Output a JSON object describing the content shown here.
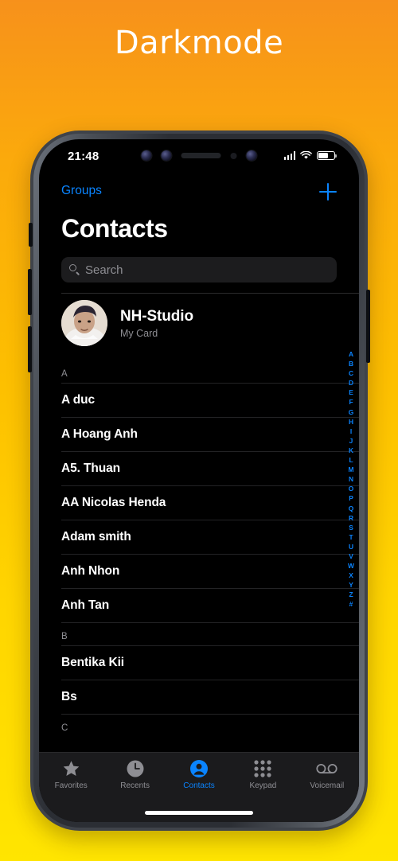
{
  "page": {
    "heading": "Darkmode"
  },
  "colors": {
    "accent": "#0a84ff",
    "screen_bg": "#000000",
    "secondary_text": "#8e8e93",
    "bg_gradient_top": "#f7911b",
    "bg_gradient_bottom": "#ffe500"
  },
  "status_bar": {
    "time": "21:48",
    "signal_icon": "cellular-signal-icon",
    "wifi_icon": "wifi-icon",
    "battery_icon": "battery-icon",
    "battery_level_percent": 62
  },
  "nav_bar": {
    "groups_label": "Groups",
    "add_icon": "plus-icon"
  },
  "header": {
    "title": "Contacts"
  },
  "search": {
    "placeholder": "Search",
    "value": "",
    "icon": "search-icon"
  },
  "my_card": {
    "name": "NH-Studio",
    "subtitle": "My Card",
    "avatar": "user-photo-avatar"
  },
  "contacts": {
    "sections": [
      {
        "letter": "A",
        "rows": [
          "A duc",
          "A Hoang Anh",
          "A5. Thuan",
          "AA Nicolas Henda",
          "Adam smith",
          "Anh Nhon",
          "Anh Tan"
        ]
      },
      {
        "letter": "B",
        "rows": [
          "Bentika Kii",
          "Bs"
        ]
      },
      {
        "letter": "C",
        "rows": []
      }
    ]
  },
  "index_rail": {
    "letters": [
      "A",
      "B",
      "C",
      "D",
      "E",
      "F",
      "G",
      "H",
      "I",
      "J",
      "K",
      "L",
      "M",
      "N",
      "O",
      "P",
      "Q",
      "R",
      "S",
      "T",
      "U",
      "V",
      "W",
      "X",
      "Y",
      "Z",
      "#"
    ]
  },
  "tab_bar": {
    "tabs": [
      {
        "label": "Favorites",
        "icon": "star-icon",
        "active": false
      },
      {
        "label": "Recents",
        "icon": "clock-icon",
        "active": false
      },
      {
        "label": "Contacts",
        "icon": "person-circle-icon",
        "active": true
      },
      {
        "label": "Keypad",
        "icon": "keypad-grid-icon",
        "active": false
      },
      {
        "label": "Voicemail",
        "icon": "voicemail-icon",
        "active": false
      }
    ]
  }
}
